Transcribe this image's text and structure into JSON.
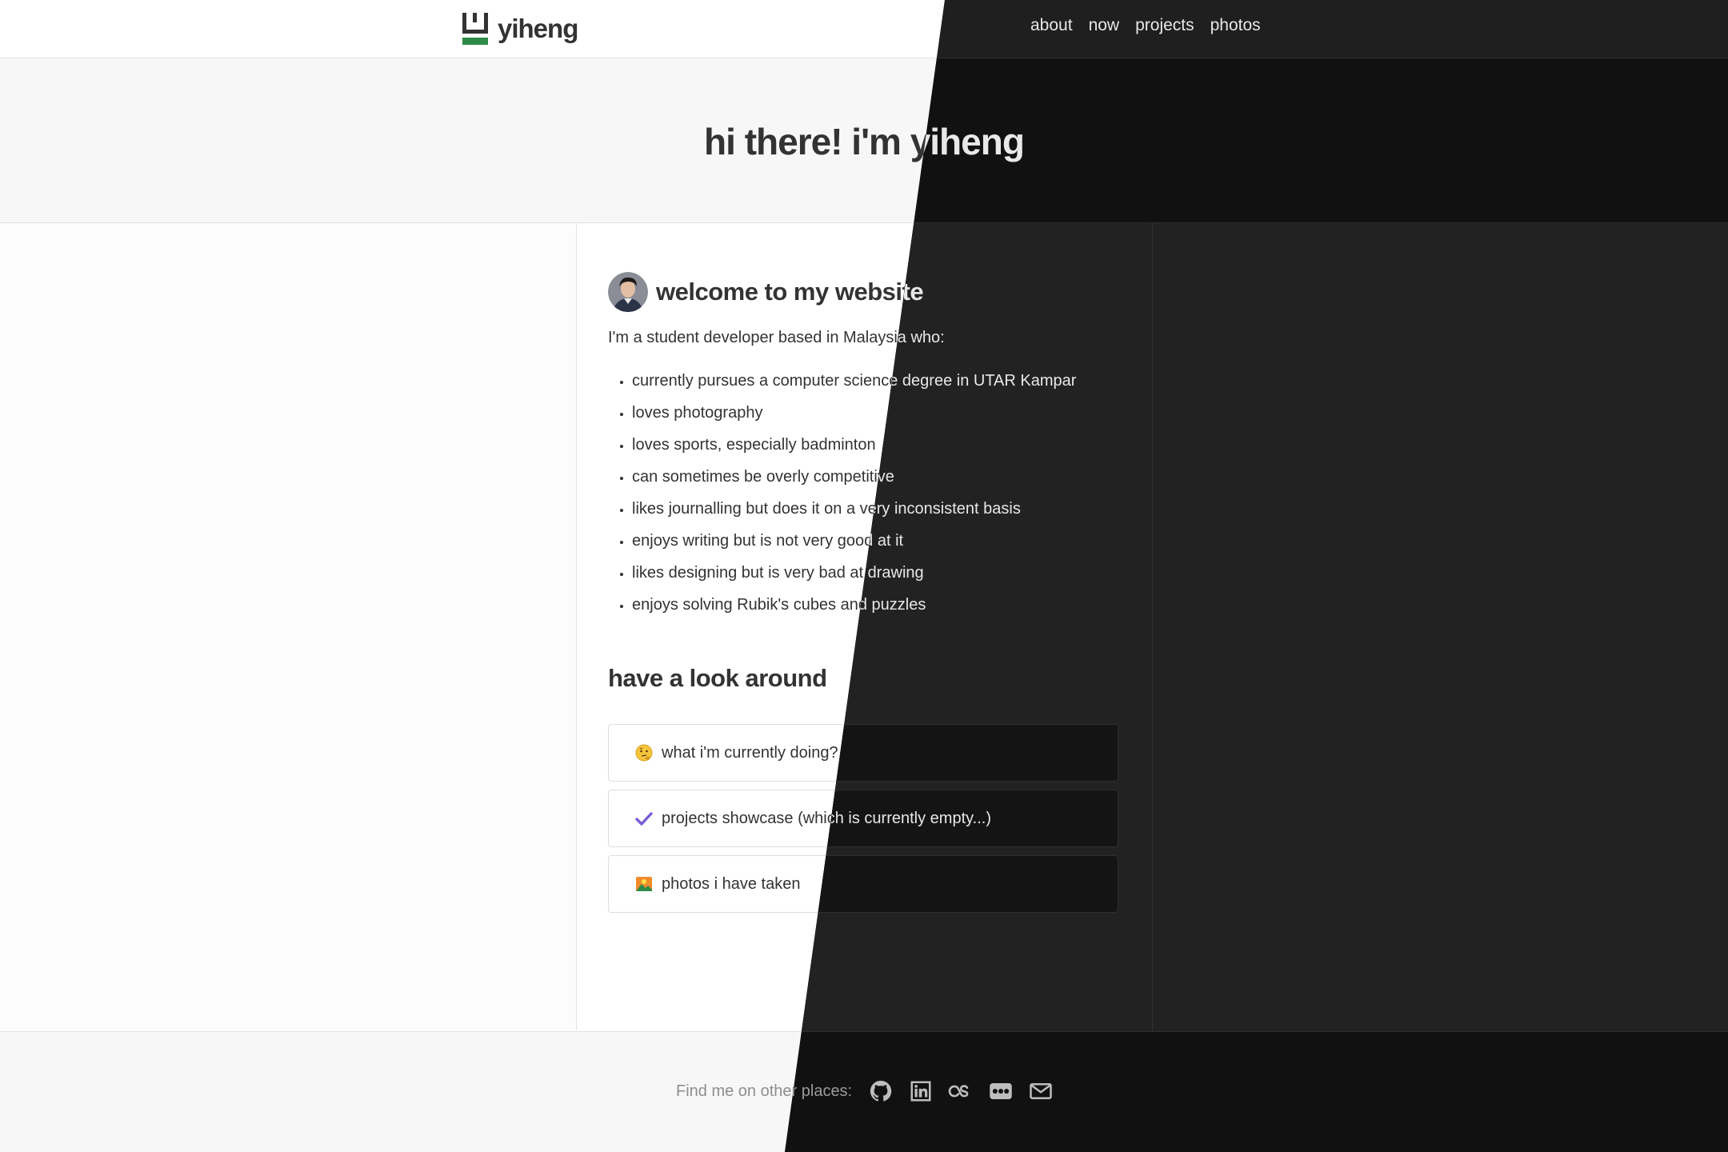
{
  "site": {
    "brand": "yiheng",
    "logo_icon": "logo-icon",
    "logo_colors": {
      "bracket_light": "#333333",
      "bracket_dark": "#e6e6e6",
      "underline": "#2e8b47"
    }
  },
  "nav": {
    "items": [
      {
        "label": "about"
      },
      {
        "label": "now"
      },
      {
        "label": "projects"
      },
      {
        "label": "photos"
      }
    ]
  },
  "hero": {
    "title": "hi there! i'm yiheng"
  },
  "welcome": {
    "title": "welcome to my website",
    "avatar_icon": "avatar",
    "intro": "I'm a student developer based in Malaysia who:",
    "traits": [
      "currently pursues a computer science degree in UTAR Kampar",
      "loves photography",
      "loves sports, especially badminton",
      "can sometimes be overly competitive",
      "likes journalling but does it on a very inconsistent basis",
      "enjoys writing but is not very good at it",
      "likes designing but is very bad at drawing",
      "enjoys solving Rubik's cubes and puzzles"
    ]
  },
  "look_around": {
    "title": "have a look around",
    "cards": [
      {
        "label": "what i'm currently doing?",
        "icon": "thinking-face-icon"
      },
      {
        "label": "projects showcase (which is currently empty...)",
        "icon": "checkmark-icon"
      },
      {
        "label": "photos i have taken",
        "icon": "photo-icon"
      }
    ]
  },
  "footer": {
    "label": "Find me on other places:",
    "socials": [
      "github-icon",
      "linkedin-icon",
      "lastfm-icon",
      "flickr-icon",
      "email-icon"
    ]
  },
  "theme": {
    "light_bg": "#fcfcfc",
    "dark_bg": "#222222",
    "accent_green": "#2e8b47",
    "check_purple": "#7b5cd6"
  }
}
